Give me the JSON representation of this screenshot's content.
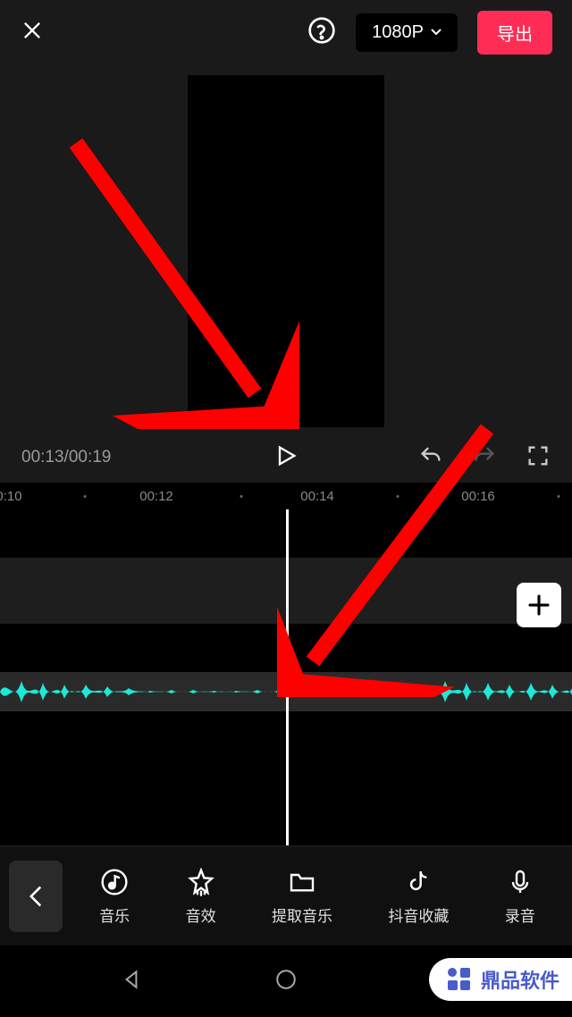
{
  "header": {
    "resolution": "1080P",
    "export": "导出"
  },
  "playback": {
    "current_time": "00:13",
    "total_time": "00:19",
    "timecode": "00:13/00:19"
  },
  "ruler": {
    "ticks": [
      "0:10",
      "00:12",
      "00:14",
      "00:16"
    ]
  },
  "tools": {
    "music": "音乐",
    "sound_effect": "音效",
    "extract_audio": "提取音乐",
    "douyin_favorites": "抖音收藏",
    "record": "录音"
  },
  "watermark": {
    "text": "鼎品软件"
  },
  "colors": {
    "accent": "#ff2d55",
    "waveform": "#1de9d6"
  }
}
